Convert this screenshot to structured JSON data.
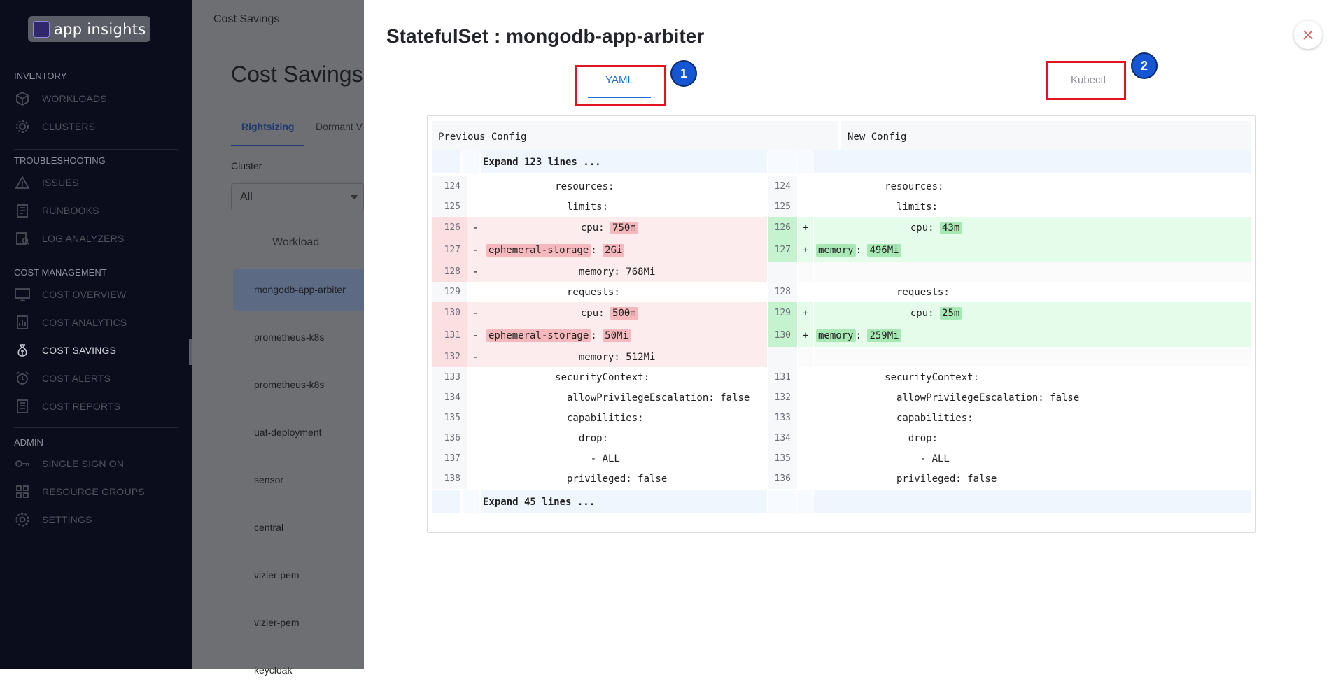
{
  "sidebar": {
    "logo_text": "app insights",
    "sections": [
      {
        "title": "INVENTORY",
        "items": [
          {
            "label": "WORKLOADS",
            "icon": "cube-icon"
          },
          {
            "label": "CLUSTERS",
            "icon": "gear-icon"
          }
        ]
      },
      {
        "title": "TROUBLESHOOTING",
        "items": [
          {
            "label": "ISSUES",
            "icon": "warning-icon"
          },
          {
            "label": "RUNBOOKS",
            "icon": "book-icon"
          },
          {
            "label": "LOG ANALYZERS",
            "icon": "log-analyzer-icon"
          }
        ]
      },
      {
        "title": "COST MANAGEMENT",
        "items": [
          {
            "label": "COST OVERVIEW",
            "icon": "monitor-icon"
          },
          {
            "label": "COST ANALYTICS",
            "icon": "analytics-icon"
          },
          {
            "label": "COST SAVINGS",
            "icon": "money-bag-icon",
            "active": true
          },
          {
            "label": "COST ALERTS",
            "icon": "alarm-icon"
          },
          {
            "label": "COST REPORTS",
            "icon": "report-icon"
          }
        ]
      },
      {
        "title": "ADMIN",
        "items": [
          {
            "label": "SINGLE SIGN ON",
            "icon": "key-icon"
          },
          {
            "label": "RESOURCE GROUPS",
            "icon": "grid-icon"
          },
          {
            "label": "SETTINGS",
            "icon": "settings-icon"
          }
        ]
      }
    ]
  },
  "page": {
    "breadcrumb": "Cost Savings",
    "title": "Cost Savings",
    "tabs": [
      "Rightsizing",
      "Dormant V"
    ],
    "cluster_label": "Cluster",
    "cluster_value": "All",
    "workload_header": "Workload",
    "workloads": [
      "mongodb-app-arbiter",
      "prometheus-k8s",
      "prometheus-k8s",
      "uat-deployment",
      "sensor",
      "central",
      "vizier-pem",
      "vizier-pem",
      "keycloak"
    ]
  },
  "modal": {
    "title": "StatefulSet : mongodb-app-arbiter",
    "tabs": {
      "yaml": "YAML",
      "kubectl": "Kubectl"
    },
    "badges": [
      "1",
      "2"
    ],
    "diff": {
      "prev_header": "Previous Config",
      "new_header": "New Config",
      "expand_top": "Expand 123 lines ...",
      "expand_bottom": "Expand 45 lines ...",
      "rows": [
        {
          "type": "ctx",
          "l_num": "124",
          "l_text": "            resources:",
          "r_num": "124",
          "r_text": "            resources:"
        },
        {
          "type": "ctx",
          "l_num": "125",
          "l_text": "              limits:",
          "r_num": "125",
          "r_text": "              limits:"
        },
        {
          "type": "chg",
          "l_num": "126",
          "l_sign": "-",
          "l_parts": [
            [
              "                cpu: ",
              false
            ],
            [
              "750m",
              true
            ]
          ],
          "r_num": "126",
          "r_sign": "+",
          "r_parts": [
            [
              "                cpu: ",
              false
            ],
            [
              "43m",
              true
            ]
          ]
        },
        {
          "type": "chg",
          "l_num": "127",
          "l_sign": "-",
          "l_parts": [
            [
              "ephemeral-storage",
              true
            ],
            [
              ": ",
              false
            ],
            [
              "2Gi",
              true
            ]
          ],
          "r_num": "127",
          "r_sign": "+",
          "r_parts": [
            [
              "memory",
              true
            ],
            [
              ": ",
              false
            ],
            [
              "496Mi",
              true
            ]
          ]
        },
        {
          "type": "del",
          "l_num": "128",
          "l_sign": "-",
          "l_parts": [
            [
              "                memory: 768Mi",
              false
            ]
          ]
        },
        {
          "type": "ctx",
          "l_num": "129",
          "l_text": "              requests:",
          "r_num": "128",
          "r_text": "              requests:"
        },
        {
          "type": "chg",
          "l_num": "130",
          "l_sign": "-",
          "l_parts": [
            [
              "                cpu: ",
              false
            ],
            [
              "500m",
              true
            ]
          ],
          "r_num": "129",
          "r_sign": "+",
          "r_parts": [
            [
              "                cpu: ",
              false
            ],
            [
              "25m",
              true
            ]
          ]
        },
        {
          "type": "chg",
          "l_num": "131",
          "l_sign": "-",
          "l_parts": [
            [
              "ephemeral-storage",
              true
            ],
            [
              ": ",
              false
            ],
            [
              "50Mi",
              true
            ]
          ],
          "r_num": "130",
          "r_sign": "+",
          "r_parts": [
            [
              "memory",
              true
            ],
            [
              ": ",
              false
            ],
            [
              "259Mi",
              true
            ]
          ]
        },
        {
          "type": "del",
          "l_num": "132",
          "l_sign": "-",
          "l_parts": [
            [
              "                memory: 512Mi",
              false
            ]
          ]
        },
        {
          "type": "ctx",
          "l_num": "133",
          "l_text": "            securityContext:",
          "r_num": "131",
          "r_text": "            securityContext:"
        },
        {
          "type": "ctx",
          "l_num": "134",
          "l_text": "              allowPrivilegeEscalation: false",
          "r_num": "132",
          "r_text": "              allowPrivilegeEscalation: false"
        },
        {
          "type": "ctx",
          "l_num": "135",
          "l_text": "              capabilities:",
          "r_num": "133",
          "r_text": "              capabilities:"
        },
        {
          "type": "ctx",
          "l_num": "136",
          "l_text": "                drop:",
          "r_num": "134",
          "r_text": "                drop:"
        },
        {
          "type": "ctx",
          "l_num": "137",
          "l_text": "                  - ALL",
          "r_num": "135",
          "r_text": "                  - ALL"
        },
        {
          "type": "ctx",
          "l_num": "138",
          "l_text": "              privileged: false",
          "r_num": "136",
          "r_text": "              privileged: false"
        }
      ]
    }
  },
  "colors": {
    "sidebar_bg": "#0b0d1d",
    "accent": "#1c6fd6",
    "annotation_red": "#e1141f",
    "badge_blue": "#1556d4",
    "del_bg": "#fdecee",
    "del_hl": "#f5b9bd",
    "add_bg": "#e6fcea",
    "add_hl": "#a8e8b4",
    "expand_bg": "#f0f6fd"
  }
}
